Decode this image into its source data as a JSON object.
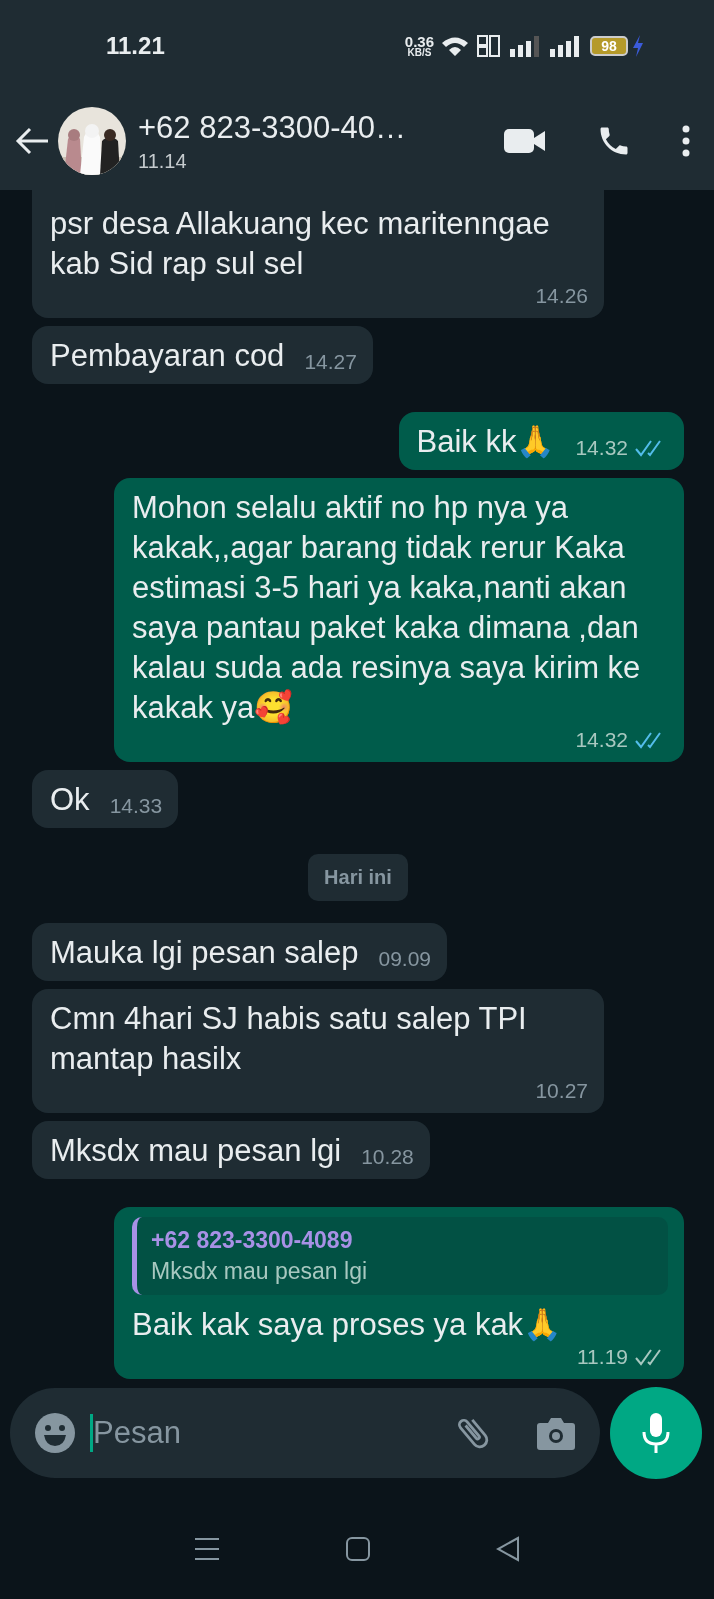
{
  "status_bar": {
    "time": "11.21",
    "speed": "0.36",
    "speed_unit": "KB/S",
    "battery": "98",
    "charging": true
  },
  "header": {
    "title": "+62 823-3300-40…",
    "subtitle": "11.14"
  },
  "messages": [
    {
      "kind": "incoming",
      "text": "psr desa Allakuang kec maritenngae kab Sid rap sul sel",
      "time": "14.26"
    },
    {
      "kind": "incoming",
      "text": "Pembayaran cod",
      "time": "14.27"
    },
    {
      "kind": "outgoing",
      "text": "Baik kk🙏",
      "time": "14.32",
      "read": true
    },
    {
      "kind": "outgoing",
      "text": "Mohon selalu aktif no hp nya ya kakak,,agar barang tidak rerur Kaka estimasi 3-5 hari ya kaka,nanti akan saya pantau paket kaka dimana ,dan kalau suda ada resinya saya kirim ke kakak ya🥰",
      "time": "14.32",
      "read": true
    },
    {
      "kind": "incoming",
      "text": "Ok",
      "time": "14.33"
    },
    {
      "kind": "date",
      "text": "Hari ini"
    },
    {
      "kind": "incoming",
      "text": "Mauka lgi pesan salep",
      "time": "09.09"
    },
    {
      "kind": "incoming",
      "text": "Cmn 4hari SJ habis satu salep TPI mantap hasilx",
      "time": "10.27"
    },
    {
      "kind": "incoming",
      "text": "Mksdx mau pesan lgi",
      "time": "10.28"
    },
    {
      "kind": "outgoing",
      "quote": {
        "author": "+62 823-3300-4089",
        "text": "Mksdx mau pesan lgi"
      },
      "text": "Baik kak saya proses ya kak🙏",
      "time": "11.19",
      "read": false
    }
  ],
  "composer": {
    "placeholder": "Pesan"
  }
}
